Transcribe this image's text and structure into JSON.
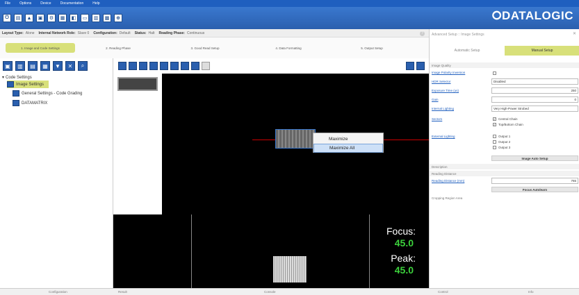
{
  "menu": [
    "File",
    "Options",
    "Device",
    "Documentation",
    "Help"
  ],
  "brand": "⭘DATALOGIC",
  "toolbar_icons": [
    "connect-icon",
    "open-icon",
    "save-icon",
    "device-icon",
    "settings-icon",
    "capture-icon",
    "monitor-icon",
    "view-icon",
    "statistics-icon",
    "compare-icon",
    "network-icon"
  ],
  "status": {
    "layout_label": "Layout Type:",
    "layout_value": "Alone",
    "role_label": "Internal Network Role:",
    "role_value": "Slave 0",
    "config_label": "Configuration:",
    "config_value": "Default",
    "status_label": "Status:",
    "status_value": "Halt",
    "phase_label": "Reading Phase:",
    "phase_value": "Continuous"
  },
  "steps": [
    "1. Image and Code Settings",
    "2. Reading Phase",
    "3. Good Read Setup",
    "4. Data Formatting",
    "5. Output Setup"
  ],
  "tree": {
    "root": "Code Settings",
    "items": [
      "Image Settings",
      "General Settings - Code Grading",
      "DATAMATRIX"
    ]
  },
  "context_menu": [
    "Maximize",
    "Maximize All"
  ],
  "graph": {
    "focus_label": "Focus:",
    "focus_value": "45.0",
    "peak_label": "Peak:",
    "peak_value": "45.0"
  },
  "bottom_tabs": [
    "Configuration",
    "Result",
    "Console",
    "Control",
    "Info"
  ],
  "right": {
    "title": "Advanced Setup :: Image Settings",
    "auto_tab": "Automatic Setup",
    "manual_tab": "Manual Setup",
    "section_quality": "Image Quality",
    "params": [
      {
        "label": "Image Polarity Inversion",
        "value": ""
      },
      {
        "label": "HDR Selector",
        "value": "Disabled"
      },
      {
        "label": "Exposure Time (us)",
        "value": "250"
      },
      {
        "label": "Gain",
        "value": "0"
      },
      {
        "label": "Internal Lighting",
        "value": "Very High-Power Strobed"
      }
    ],
    "sectors_label": "Sectors",
    "sectors": [
      "Central Chain",
      "Top/Bottom Chain"
    ],
    "ext_label": "External Lighting",
    "outputs": [
      "Output 1",
      "Output 2",
      "Output 3"
    ],
    "auto_bar": "Image Auto Setup",
    "section_desc": "Description",
    "section_dist": "Reading Distance",
    "dist_label": "Reading Distance (mm)",
    "dist_value": "765",
    "focus_bar": "Focus Autolearn",
    "section_crop": "Cropping Region Area"
  }
}
